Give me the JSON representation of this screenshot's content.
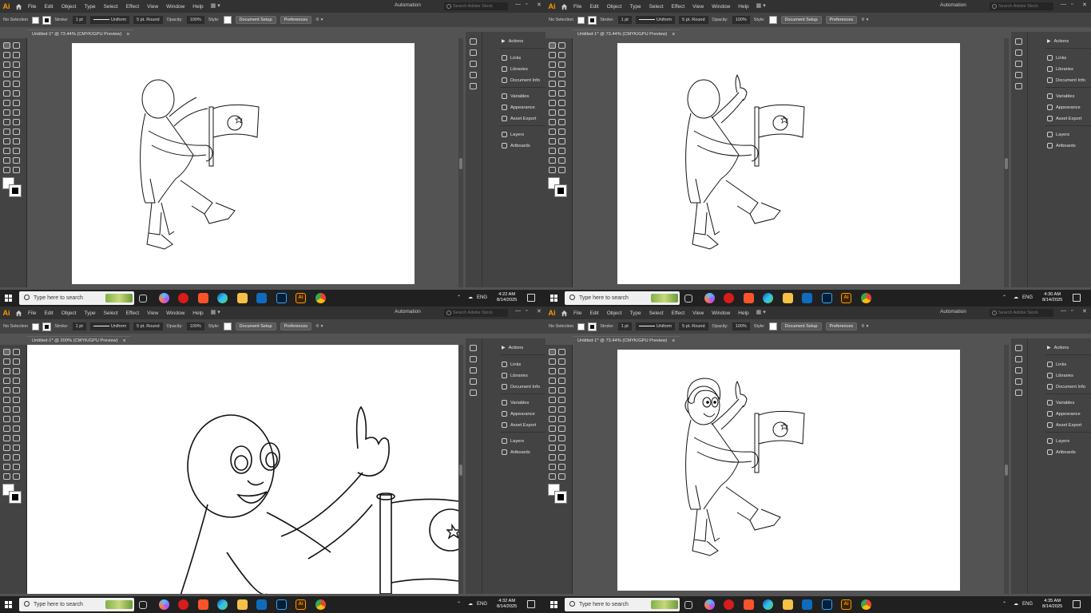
{
  "app": {
    "logo_text": "Ai",
    "menu": [
      "File",
      "Edit",
      "Object",
      "Type",
      "Select",
      "Effect",
      "View",
      "Window",
      "Help"
    ],
    "automation_label": "Automation",
    "brand_color": "#ff9a00"
  },
  "control_bar": {
    "selection": "No Selection",
    "stroke_label": "Stroke:",
    "stroke_weight": "1 pt",
    "stroke_profile": "Uniform",
    "brush": "5 pt. Round",
    "opacity_label": "Opacity:",
    "opacity_value": "100%",
    "style_label": "Style:",
    "doc_setup": "Document Setup",
    "preferences": "Preferences"
  },
  "panel": {
    "groups": [
      [
        "Actions"
      ],
      [
        "Links",
        "Libraries",
        "Document Info"
      ],
      [
        "Variables",
        "Appearance",
        "Asset Export"
      ],
      [
        "Layers",
        "Artboards"
      ]
    ]
  },
  "taskbar": {
    "search_placeholder": "Type here to search",
    "lang": "ENG",
    "date": "8/14/2025"
  },
  "quadrants": [
    {
      "search_placeholder": "Search Adobe Stock",
      "doc_tab": "Untitled-1* @ 73.44% (CMYK/GPU Preview)",
      "time": "4:22 AM"
    },
    {
      "search_placeholder": "Search Adobe Stock",
      "doc_tab": "Untitled-1* @ 73.44% (CMYK/GPU Preview)",
      "time": "4:30 AM"
    },
    {
      "search_placeholder": "Search Adobe Stock",
      "doc_tab": "Untitled-1* @ 200% (CMYK/GPU Preview)",
      "time": "4:32 AM"
    },
    {
      "search_placeholder": "Search Adobe Stock",
      "doc_tab": "Untitled-1* @ 73.44% (CMYK/GPU Preview)",
      "time": "4:35 AM"
    }
  ]
}
